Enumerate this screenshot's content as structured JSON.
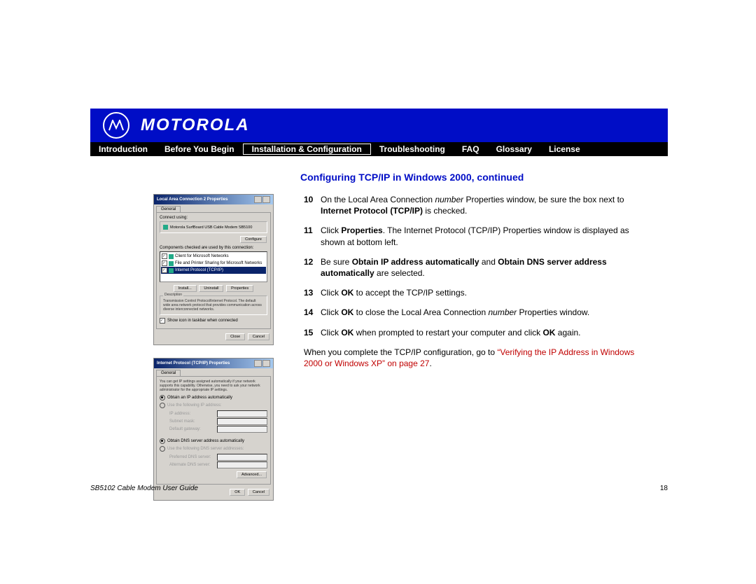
{
  "brand": "MOTOROLA",
  "nav": {
    "items": [
      {
        "label": "Introduction"
      },
      {
        "label": "Before You Begin"
      },
      {
        "label": "Installation & Configuration",
        "active": true
      },
      {
        "label": "Troubleshooting"
      },
      {
        "label": "FAQ"
      },
      {
        "label": "Glossary"
      },
      {
        "label": "License"
      }
    ]
  },
  "section_title": "Configuring TCP/IP in Windows 2000, continued",
  "screenshot1": {
    "title": "Local Area Connection 2 Properties",
    "tab": "General",
    "connect_label": "Connect using:",
    "adapter": "Motorola SurfBoard USB Cable Modem SB5100",
    "configure_btn": "Configure",
    "components_label": "Components checked are used by this connection:",
    "items": [
      {
        "checked": true,
        "label": "Client for Microsoft Networks"
      },
      {
        "checked": true,
        "label": "File and Printer Sharing for Microsoft Networks"
      },
      {
        "checked": true,
        "label": "Internet Protocol (TCP/IP)",
        "selected": true
      }
    ],
    "btn_install": "Install...",
    "btn_uninstall": "Uninstall",
    "btn_properties": "Properties",
    "desc_label": "Description",
    "desc": "Transmission Control Protocol/Internet Protocol. The default wide area network protocol that provides communication across diverse interconnected networks.",
    "show_icon_cb": "Show icon in taskbar when connected",
    "btn_close": "Close",
    "btn_cancel": "Cancel"
  },
  "screenshot2": {
    "title": "Internet Protocol (TCP/IP) Properties",
    "tab": "General",
    "intro": "You can get IP settings assigned automatically if your network supports this capability. Otherwise, you need to ask your network administrator for the appropriate IP settings.",
    "r1": "Obtain an IP address automatically",
    "r2": "Use the following IP address:",
    "f_ip": "IP address:",
    "f_mask": "Subnet mask:",
    "f_gw": "Default gateway:",
    "r3": "Obtain DNS server address automatically",
    "r4": "Use the following DNS server addresses:",
    "f_dns1": "Preferred DNS server:",
    "f_dns2": "Alternate DNS server:",
    "btn_adv": "Advanced...",
    "btn_ok": "OK",
    "btn_cancel": "Cancel"
  },
  "steps": [
    {
      "num": "10",
      "parts": [
        {
          "t": "On the Local Area Connection "
        },
        {
          "t": "number",
          "i": true
        },
        {
          "t": " Properties window, be sure the box next to "
        },
        {
          "t": "Internet Protocol (TCP/IP)",
          "b": true
        },
        {
          "t": " is checked."
        }
      ]
    },
    {
      "num": "11",
      "parts": [
        {
          "t": "Click "
        },
        {
          "t": "Properties",
          "b": true
        },
        {
          "t": ". The Internet Protocol (TCP/IP) Properties window is displayed as shown at bottom left."
        }
      ]
    },
    {
      "num": "12",
      "parts": [
        {
          "t": "Be sure "
        },
        {
          "t": "Obtain IP address automatically",
          "b": true
        },
        {
          "t": " and "
        },
        {
          "t": "Obtain DNS server address automatically",
          "b": true
        },
        {
          "t": " are selected."
        }
      ]
    },
    {
      "num": "13",
      "parts": [
        {
          "t": "Click "
        },
        {
          "t": "OK",
          "b": true
        },
        {
          "t": " to accept the TCP/IP settings."
        }
      ]
    },
    {
      "num": "14",
      "parts": [
        {
          "t": "Click "
        },
        {
          "t": "OK",
          "b": true
        },
        {
          "t": " to close the Local Area Connection "
        },
        {
          "t": "number",
          "i": true
        },
        {
          "t": " Properties window."
        }
      ]
    },
    {
      "num": "15",
      "parts": [
        {
          "t": "Click "
        },
        {
          "t": "OK",
          "b": true
        },
        {
          "t": " when prompted to restart your computer and click "
        },
        {
          "t": "OK",
          "b": true
        },
        {
          "t": " again."
        }
      ]
    }
  ],
  "final": {
    "pre": "When you complete the TCP/IP configuration, go to ",
    "link": "“Verifying the IP Address in Windows 2000 or Windows XP” on page 27",
    "post": "."
  },
  "footer": {
    "left": "SB5102 Cable Modem User Guide",
    "page": "18"
  }
}
